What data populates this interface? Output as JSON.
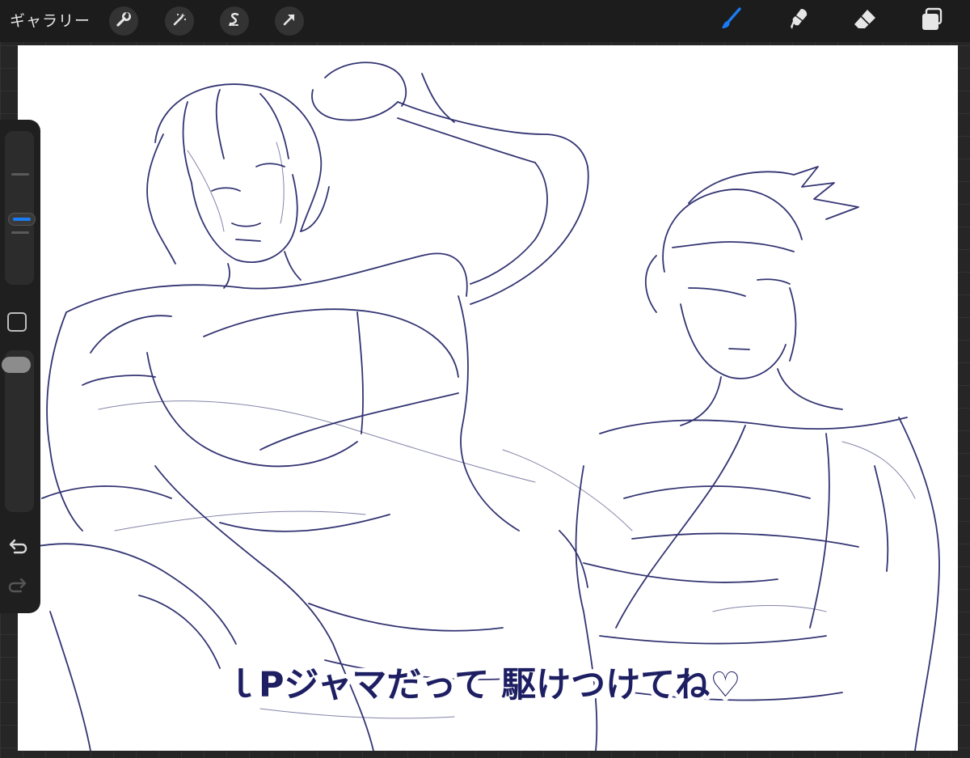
{
  "app": {
    "gallery_label": "ギャラリー"
  },
  "toolbar_left": [
    {
      "name": "actions-wrench-icon"
    },
    {
      "name": "adjustments-wand-icon"
    },
    {
      "name": "selection-s-icon"
    },
    {
      "name": "transform-arrow-icon"
    }
  ],
  "toolbar_right": [
    {
      "name": "brush-icon",
      "active": true
    },
    {
      "name": "smudge-icon",
      "active": false
    },
    {
      "name": "eraser-icon",
      "active": false
    },
    {
      "name": "layers-icon",
      "active": false
    }
  ],
  "colors": {
    "accent": "#1a7cf5",
    "ink": "#1e1f63",
    "toolbar_bg": "#1c1c1c",
    "canvas_bg": "#ffffff"
  },
  "canvas": {
    "caption": "ｌPジャマだって 駆けつけてね♡"
  },
  "sidebar": {
    "brush_size_level": 0.55,
    "opacity_level": 0.05
  }
}
